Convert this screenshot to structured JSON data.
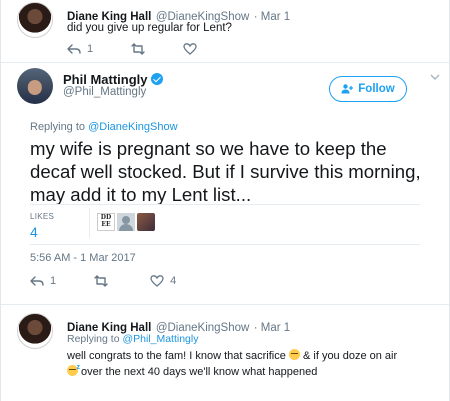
{
  "reply_top": {
    "name": "Diane King Hall",
    "handle": "@DianeKingShow",
    "time": "· Mar 1",
    "text": "did you give up regular for Lent?",
    "reply_count": "1"
  },
  "main_tweet": {
    "name": "Phil Mattingly",
    "handle": "@Phil_Mattingly",
    "follow_label": "Follow",
    "replying_prefix": "Replying to ",
    "replying_to": "@DianeKingShow",
    "text": "my wife is pregnant so we have to keep the decaf well stocked. But if I survive this morning, may add it to my Lent list...",
    "likes_label": "LIKES",
    "likes_count": "4",
    "timestamp": "5:56 AM - 1 Mar 2017",
    "reply_count": "1",
    "like_count": "4"
  },
  "reply_bottom": {
    "name": "Diane King Hall",
    "handle": "@DianeKingShow",
    "time": "· Mar 1",
    "replying_prefix": "Replying to ",
    "replying_to": "@Phil_Mattingly",
    "text_1": "well congrats to the fam! I know that sacrifice ",
    "text_2": " & if you doze on air ",
    "text_3": " over the next 40 days we'll know what happened"
  },
  "icons": {
    "reply": "reply-icon",
    "retweet": "retweet-icon",
    "like": "heart-icon",
    "follow": "add-user-icon",
    "more": "chevron-down-icon"
  },
  "colors": {
    "accent": "#1da1f2",
    "link": "#1b95e0",
    "muted": "#657786",
    "divider": "#e6ecf0"
  }
}
